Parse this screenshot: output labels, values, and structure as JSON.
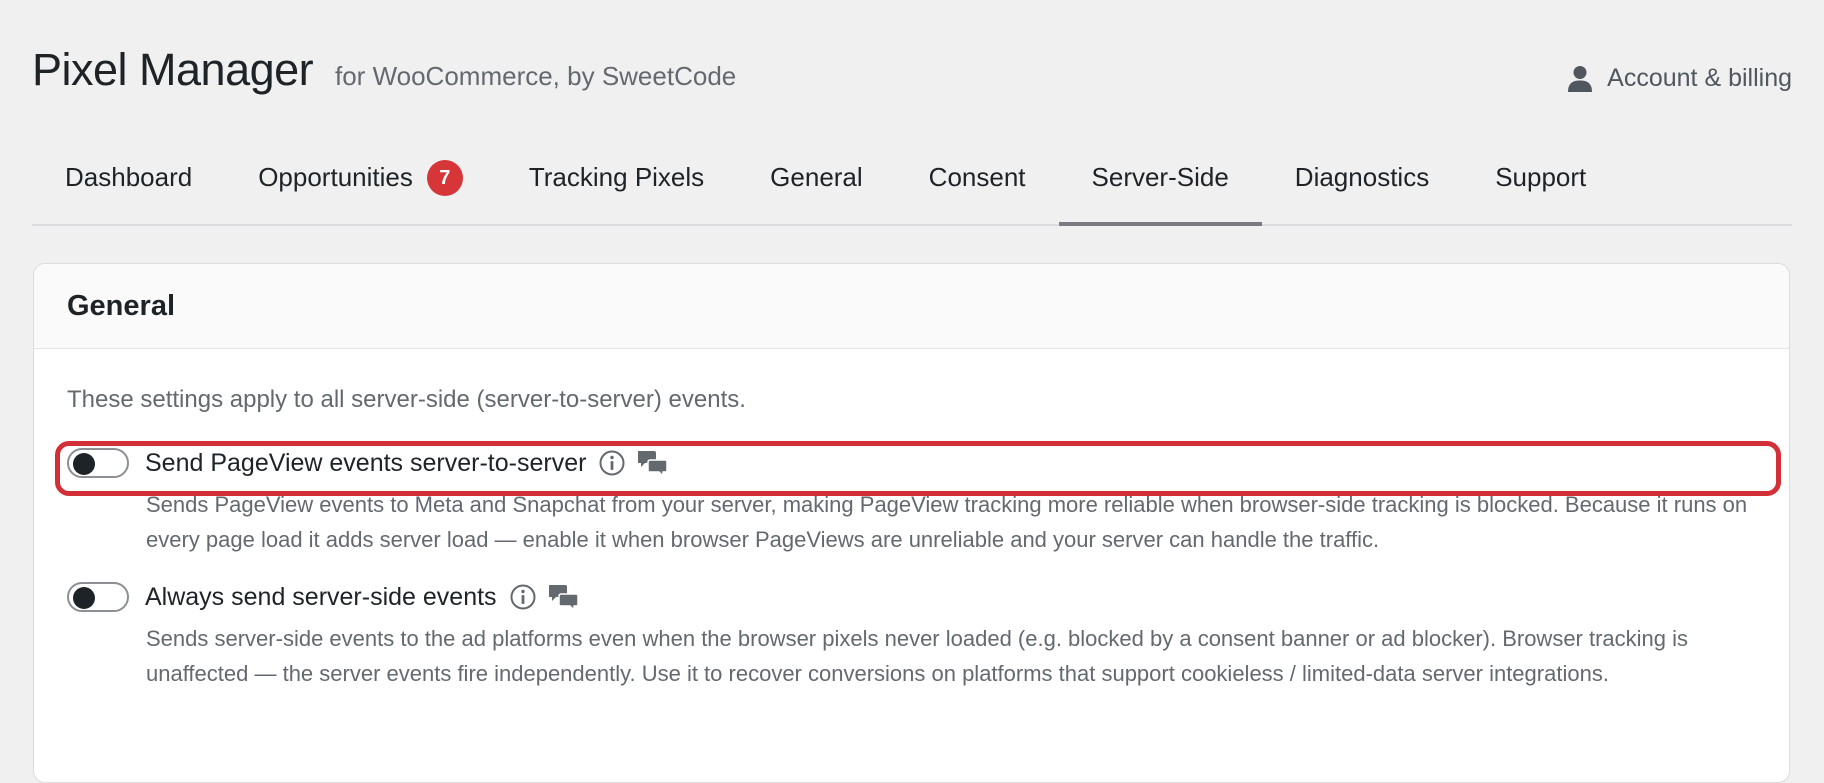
{
  "app": {
    "title": "Pixel Manager",
    "subtitle": "for WooCommerce, by SweetCode",
    "account_label": "Account & billing"
  },
  "tabs": [
    {
      "label": "Dashboard",
      "active": false
    },
    {
      "label": "Opportunities",
      "active": false,
      "badge": "7"
    },
    {
      "label": "Tracking Pixels",
      "active": false
    },
    {
      "label": "General",
      "active": false
    },
    {
      "label": "Consent",
      "active": false
    },
    {
      "label": "Server-Side",
      "active": true
    },
    {
      "label": "Diagnostics",
      "active": false
    },
    {
      "label": "Support",
      "active": false
    }
  ],
  "card": {
    "title": "General",
    "intro": "These settings apply to all server-side (server-to-server) events.",
    "settings": [
      {
        "label": "Send PageView events server-to-server",
        "enabled": false,
        "description": "Sends PageView events to Meta and Snapchat from your server, making PageView tracking more reliable when browser-side tracking is blocked. Because it runs on every page load it adds server load — enable it when browser PageViews are unreliable and your server can handle the traffic."
      },
      {
        "label": "Always send server-side events",
        "enabled": false,
        "description": "Sends server-side events to the ad platforms even when the browser pixels never loaded (e.g. blocked by a consent banner or ad blocker). Browser tracking is unaffected — the server events fire independently. Use it to recover conversions on platforms that support cookieless / limited-data server integrations."
      }
    ]
  },
  "colors": {
    "background": "#f0f0f1",
    "badge": "#d63638",
    "highlight": "#d32f37",
    "active_tab_underline": "#787c82"
  }
}
